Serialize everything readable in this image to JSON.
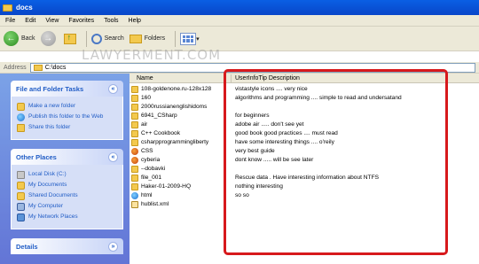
{
  "window": {
    "title": "docs"
  },
  "menu": [
    "File",
    "Edit",
    "View",
    "Favorites",
    "Tools",
    "Help"
  ],
  "toolbar": {
    "back_label": "Back",
    "search_label": "Search",
    "folders_label": "Folders"
  },
  "watermark": "LAWYERMENT.COM",
  "address": {
    "label": "Address",
    "value": "C:\\docs"
  },
  "left_pane": {
    "file_tasks": {
      "title": "File and Folder Tasks",
      "items": [
        "Make a new folder",
        "Publish this folder to the Web",
        "Share this folder"
      ]
    },
    "other_places": {
      "title": "Other Places",
      "items": [
        "Local Disk (C:)",
        "My Documents",
        "Shared Documents",
        "My Computer",
        "My Network Places"
      ]
    },
    "details": {
      "title": "Details"
    }
  },
  "columns": {
    "name": "Name",
    "tip": "UserInfoTip Description"
  },
  "files": [
    {
      "name": "108-goldenone.ru-128x128",
      "tip": "vistastyle icons .... very nice",
      "icon": "folder"
    },
    {
      "name": "160",
      "tip": "algorithms and programming .... simple to read and undersatand",
      "icon": "folder"
    },
    {
      "name": "2000russianenglishidoms",
      "tip": "",
      "icon": "folder"
    },
    {
      "name": "6941_CSharp",
      "tip": "for beginners",
      "icon": "folder"
    },
    {
      "name": "air",
      "tip": "adobe air ..... don't see yet",
      "icon": "folder"
    },
    {
      "name": "C++ Cookbook",
      "tip": "good book good practices .... must read",
      "icon": "folder"
    },
    {
      "name": "csharpprogrammingliberty",
      "tip": "have some interesting things .... o'reily",
      "icon": "folder"
    },
    {
      "name": "CSS",
      "tip": "very best guide",
      "icon": "firefox"
    },
    {
      "name": "cyberia",
      "tip": "dont know ..... will be see later",
      "icon": "firefox"
    },
    {
      "name": "--dobavki",
      "tip": "",
      "icon": "folder"
    },
    {
      "name": "file_001",
      "tip": "Rescue data . Have interesting information about NTFS",
      "icon": "folder"
    },
    {
      "name": "Haker-01-2009-HQ",
      "tip": "nothing interesting",
      "icon": "folder"
    },
    {
      "name": "html",
      "tip": "so so",
      "icon": "ie"
    },
    {
      "name": "hublist.xml",
      "tip": "",
      "icon": "xml"
    }
  ],
  "colors": {
    "titlebar": "#0a5fe4",
    "task_pane": "#6f8ce0",
    "highlight": "#d7191c"
  }
}
